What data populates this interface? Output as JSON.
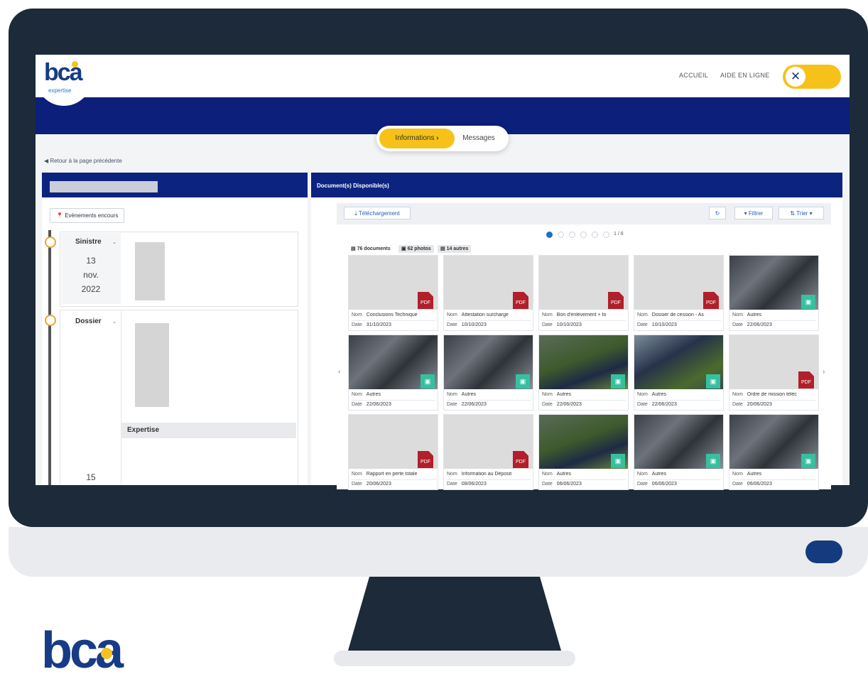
{
  "logo": {
    "text": "bca",
    "subtitle": "expertise"
  },
  "nav": {
    "home": "ACCUEIL",
    "help": "AIDE EN LIGNE"
  },
  "tabs": {
    "info": "Informations",
    "info_icon": "›",
    "messages": "Messages"
  },
  "back_link": "Retour à la page précédente",
  "left_panel": {
    "events_button": "Evènements encours",
    "sinistre": {
      "label": "Sinistre",
      "day": "13",
      "month": "nov.",
      "year": "2022"
    },
    "dossier": {
      "label": "Dossier",
      "next_day": "15"
    },
    "expertise_section": "Expertise"
  },
  "right_panel": {
    "title": "Document(s) Disponible(s)",
    "download": "Téléchargement",
    "refresh_icon": "refresh-icon",
    "filter": "Filtrer",
    "sort": "Trier",
    "pager": "1 / 6",
    "counts": {
      "documents": "76 documents",
      "photos": "62 photos",
      "others": "14 autres"
    },
    "labels": {
      "name": "Nom",
      "date": "Date"
    },
    "pdf_label": "PDF",
    "tiles": [
      {
        "name": "Conclusions Technique",
        "date": "31/10/2023"
      },
      {
        "name": "Attestation surcharge",
        "date": "10/10/2023"
      },
      {
        "name": "Bon d'enlèvement + fo",
        "date": "10/10/2023"
      },
      {
        "name": "Dossier de cession - As",
        "date": "10/10/2023"
      },
      {
        "name": "Autres",
        "date": "22/06/2023"
      },
      {
        "name": "Autres",
        "date": "22/06/2023"
      },
      {
        "name": "Autres",
        "date": "22/06/2023"
      },
      {
        "name": "Autres",
        "date": "22/06/2023"
      },
      {
        "name": "Autres",
        "date": "22/06/2023"
      },
      {
        "name": "Ordre de mission téléc",
        "date": "20/06/2023"
      },
      {
        "name": "Rapport en perte totale",
        "date": "20/06/2023"
      },
      {
        "name": "Information au Déposit",
        "date": "08/06/2023"
      },
      {
        "name": "Autres",
        "date": "06/06/2023"
      },
      {
        "name": "Autres",
        "date": "06/06/2023"
      },
      {
        "name": "Autres",
        "date": "06/06/2023"
      }
    ]
  },
  "brand_bottom": "bca"
}
